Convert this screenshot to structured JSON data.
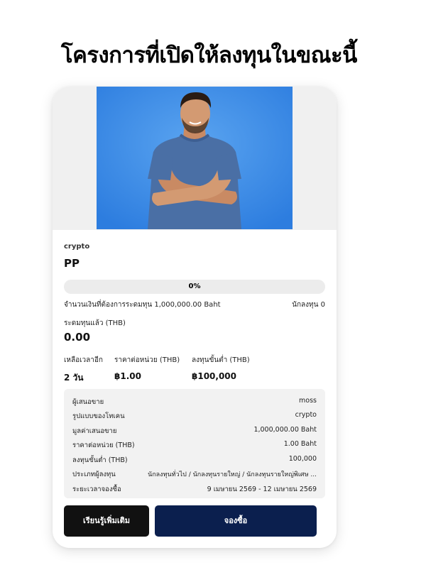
{
  "page": {
    "title": "โครงการที่เปิดให้ลงทุนในขณะนี้"
  },
  "card": {
    "image": {
      "icon": "person-photo"
    },
    "category": "crypto",
    "name": "PP",
    "progress": {
      "percent": 0,
      "label": "0%"
    },
    "target_text": "จำนวนเงินที่ต้องการระดมทุน 1,000,000.00 Baht",
    "investors_text": "นักลงทุน 0",
    "raised_label": "ระดมทุนแล้ว (THB)",
    "raised_value": "0.00",
    "stats": [
      {
        "label": "เหลือเวลาอีก",
        "value": "2 วัน"
      },
      {
        "label": "ราคาต่อหน่วย (THB)",
        "value": "฿1.00"
      },
      {
        "label": "ลงทุนขั้นต่ำ (THB)",
        "value": "฿100,000"
      }
    ],
    "details": [
      {
        "key": "ผู้เสนอขาย",
        "value": "moss"
      },
      {
        "key": "รูปแบบของโทเคน",
        "value": "crypto"
      },
      {
        "key": "มูลค่าเสนอขาย",
        "value": "1,000,000.00 Baht"
      },
      {
        "key": "ราคาต่อหน่วย (THB)",
        "value": "1.00 Baht"
      },
      {
        "key": "ลงทุนขั้นต่ำ (THB)",
        "value": "100,000"
      },
      {
        "key": "ประเภทผู้ลงทุน",
        "value": "นักลงทุนทั่วไป / นักลงทุนรายใหญ่ / นักลงทุนรายใหญ่พิเศษ ..."
      },
      {
        "key": "ระยะเวลาจองซื้อ",
        "value": "9 เมษายน 2569 - 12 เมษายน 2569"
      }
    ],
    "buttons": {
      "learn_more": "เรียนรู้เพิ่มเติม",
      "buy": "จองซื้อ"
    }
  },
  "colors": {
    "primary": "#0b1f4e",
    "dark_button": "#111111",
    "photo_background": "#3d8be6",
    "details_background": "#f2f2f2"
  }
}
